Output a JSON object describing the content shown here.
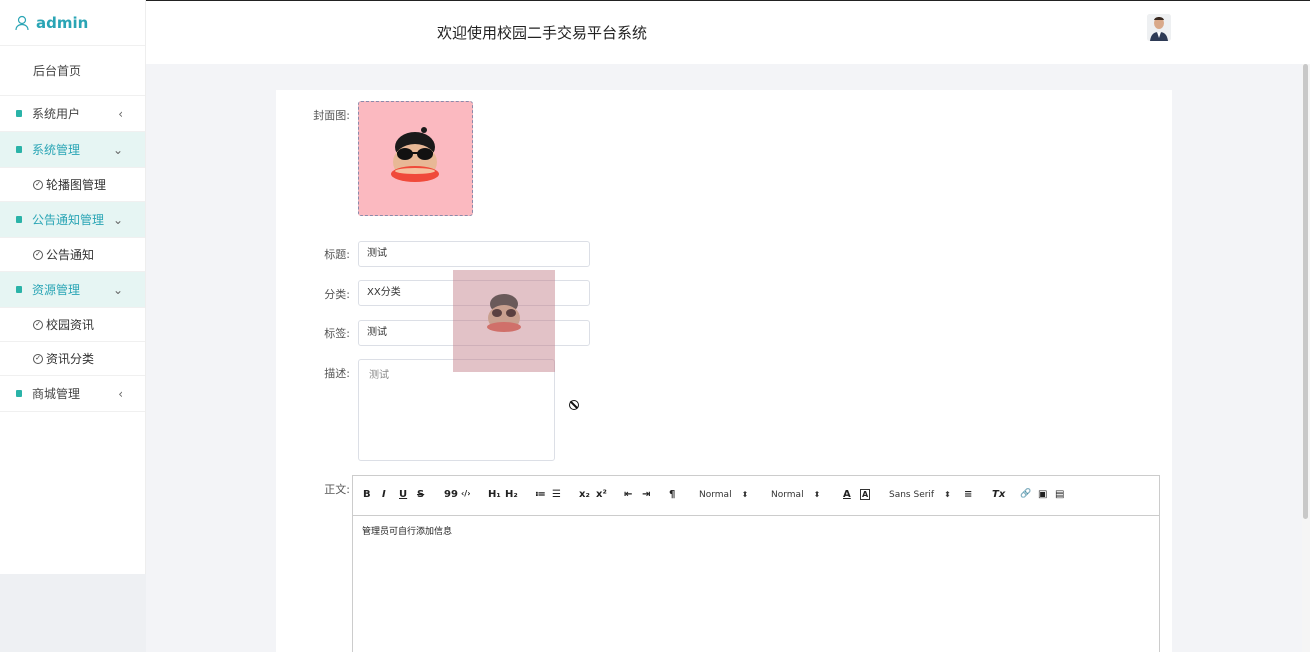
{
  "sidebar": {
    "user": "admin",
    "home": "后台首页",
    "groups": [
      {
        "label": "系统用户",
        "arrow": "<"
      },
      {
        "label": "系统管理",
        "arrow": "⌄",
        "subs": [
          "轮播图管理"
        ]
      },
      {
        "label": "公告通知管理",
        "arrow": "⌄",
        "subs": [
          "公告通知"
        ]
      },
      {
        "label": "资源管理",
        "arrow": "⌄",
        "subs": [
          "校园资讯",
          "资讯分类"
        ]
      },
      {
        "label": "商城管理",
        "arrow": "<"
      }
    ]
  },
  "header": {
    "title": "欢迎使用校园二手交易平台系统"
  },
  "form": {
    "cover_label": "封面图:",
    "title_label": "标题:",
    "title_value": "测试",
    "category_label": "分类:",
    "category_value": "XX分类",
    "tag_label": "标签:",
    "tag_value": "测试",
    "desc_label": "描述:",
    "desc_value": "测试",
    "content_label": "正文:",
    "content_value": "管理员可自行添加信息"
  },
  "editor_toolbar": {
    "bold": "B",
    "italic": "I",
    "underline": "U",
    "strike": "S",
    "quote": "99",
    "code": "‹/›",
    "h1": "H₁",
    "h2": "H₂",
    "ol": "≔",
    "ul": "☰",
    "sub": "x₂",
    "sup": "x²",
    "outdent": "⇤",
    "indent": "⇥",
    "direction": "¶",
    "size_select": "Normal",
    "header_select": "Normal",
    "font_select": "Sans Serif",
    "color": "A",
    "background": "A",
    "align": "≡",
    "clean": "Tx",
    "link": "🔗",
    "image": "▣",
    "video": "▤"
  },
  "colors": {
    "accent": "#2aa5b5",
    "cover_bg": "#fbb9c0"
  }
}
